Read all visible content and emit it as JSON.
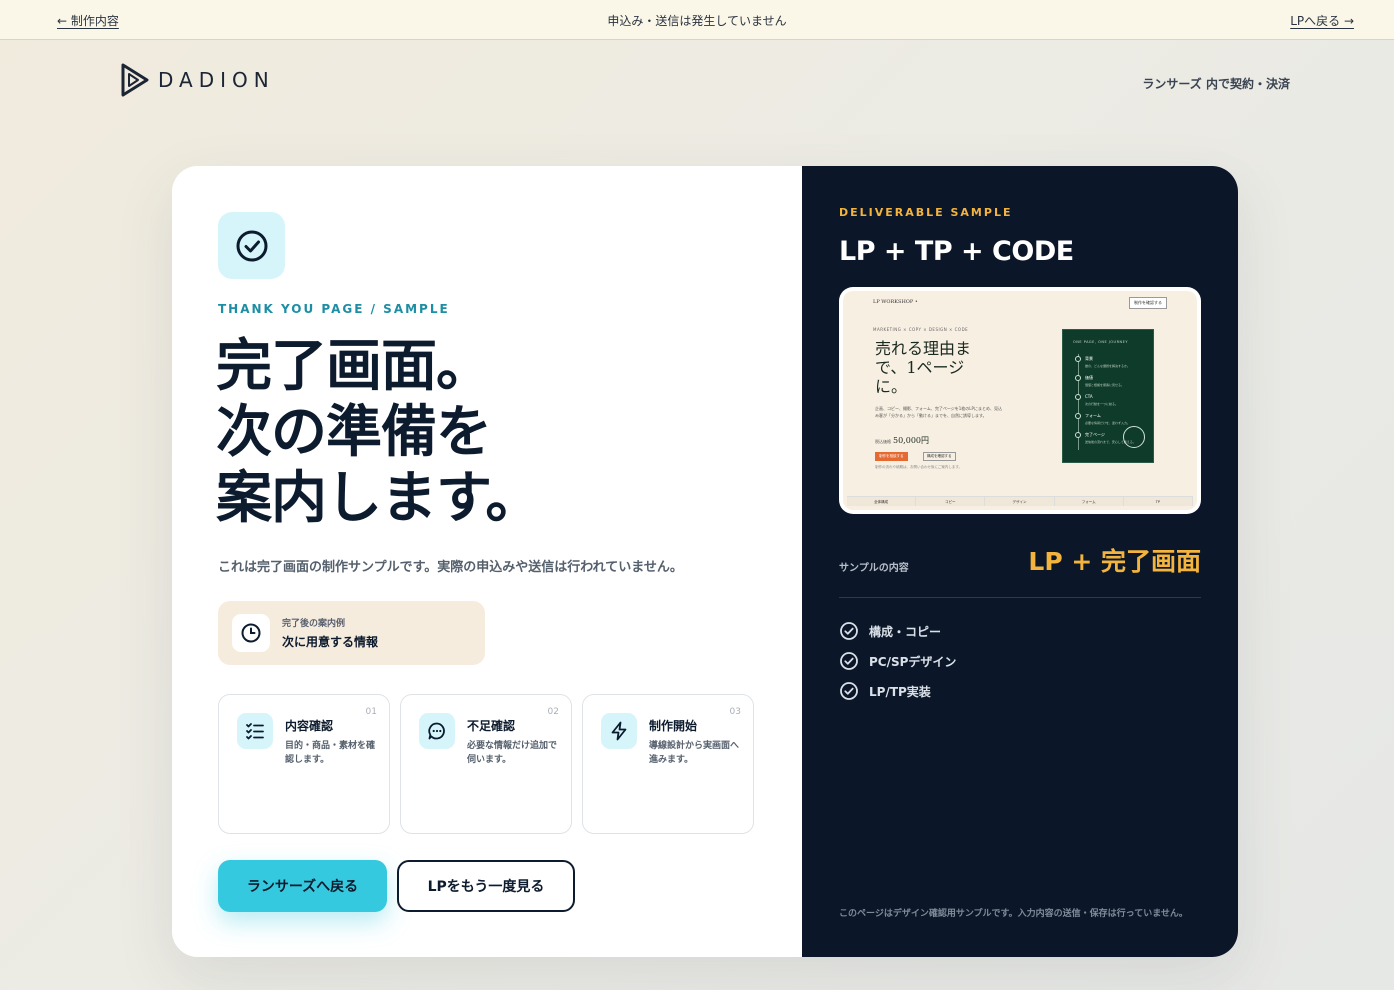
{
  "topbar": {
    "back_label": "← 制作内容",
    "notice": "申込み・送信は発生していません",
    "lp_link": "LPへ戻る →"
  },
  "header": {
    "logo_text": "DADION",
    "right_text": "ランサーズ 内で契約・決済"
  },
  "left": {
    "eyebrow": "THANK YOU PAGE / SAMPLE",
    "headline_lines": [
      "完了画面。",
      "次の準備を",
      "案内します。"
    ],
    "subline": "これは完了画面の制作サンプルです。実際の申込みや送信は行われていません。",
    "info": {
      "small": "完了後の案内例",
      "big": "次に用意する情報"
    },
    "steps": [
      {
        "num": "01",
        "title": "内容確認",
        "desc": "目的・商品・素材を確認します。",
        "icon": "checklist-icon"
      },
      {
        "num": "02",
        "title": "不足確認",
        "desc": "必要な情報だけ追加で伺います。",
        "icon": "chat-bubble-icon"
      },
      {
        "num": "03",
        "title": "制作開始",
        "desc": "導線設計から実画面へ進みます。",
        "icon": "lightning-icon"
      }
    ],
    "primary_button": "ランサーズへ戻る",
    "secondary_button": "LPをもう一度見る"
  },
  "right": {
    "eyebrow": "DELIVERABLE SAMPLE",
    "title": "LP + TP + CODE",
    "preview": {
      "brand": "LP WORKSHOP •",
      "top_button": "制作を確認する",
      "kicker": "MARKETING × COPY × DESIGN × CODE",
      "headline": "売れる理由まで、1ページに。",
      "desc": "企画、コピー、撮影、フォーム、完了ページを1枚のLPにまとめ、見込み客が「分かる」から「動ける」までを、自然に誘導します。",
      "price_label": "税込価格",
      "price": "50,000円",
      "cta": "制作を相談する",
      "cta2": "構成を確認する",
      "note": "制作の流れや納期は、お問い合わせ後にご案内します。",
      "green_kicker": "ONE PAGE, ONE JOURNEY",
      "green_items": [
        {
          "title": "背景",
          "sub": "誰の、どんな課題を解決するか。"
        },
        {
          "title": "価値",
          "sub": "価値と根拠を順番に見せる。"
        },
        {
          "title": "CTA",
          "sub": "次の行動を一つに絞る。"
        },
        {
          "title": "フォーム",
          "sub": "必要な情報だけを、迷わず入力。"
        },
        {
          "title": "完了ページ",
          "sub": "送信後の流れまで、安心して終える。"
        }
      ],
      "nav": [
        "全体構成",
        "コピー",
        "デザイン",
        "フォーム",
        "TP"
      ]
    },
    "contents_label": "サンプルの内容",
    "contents_value": "LP + 完了画面",
    "checklist": [
      "構成・コピー",
      "PC/SPデザイン",
      "LP/TP実装"
    ],
    "foot_note": "このページはデザイン確認用サンプルです。入力内容の送信・保存は行っていません。"
  },
  "colors": {
    "accent_cyan": "#35c9df",
    "accent_gold": "#f3b33d",
    "navy": "#0b1728"
  }
}
